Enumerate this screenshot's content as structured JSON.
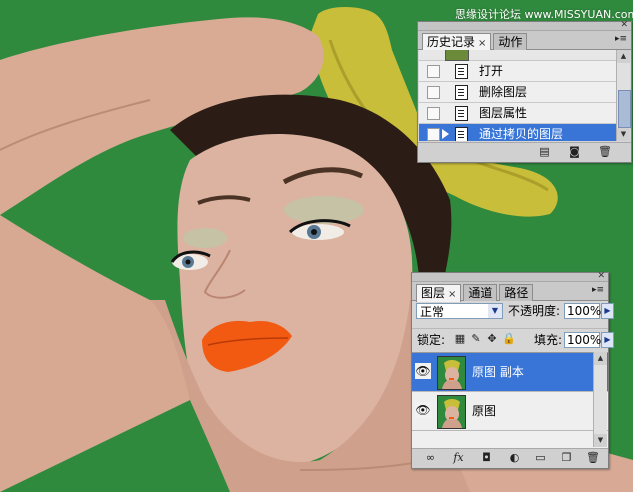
{
  "watermark": "思缘设计论坛 www.MISSYUAN.com",
  "colors": {
    "background_green": "#2f8a3e",
    "selection_blue": "#3875d7",
    "panel_gray": "#d6d6d6"
  },
  "history_panel": {
    "tabs": [
      {
        "label": "历史记录",
        "active": true,
        "close": "×"
      },
      {
        "label": "动作",
        "active": false
      }
    ],
    "menu_icon": "≡",
    "items": [
      {
        "label": "打开",
        "selected": false
      },
      {
        "label": "删除图层",
        "selected": false
      },
      {
        "label": "图层属性",
        "selected": false
      },
      {
        "label": "通过拷贝的图层",
        "selected": true
      }
    ],
    "footer_icons": [
      "new-document-from-state-icon",
      "new-snapshot-icon",
      "trash-icon"
    ]
  },
  "layers_panel": {
    "tabs": [
      {
        "label": "图层",
        "active": true,
        "close": "×"
      },
      {
        "label": "通道",
        "active": false
      },
      {
        "label": "路径",
        "active": false
      }
    ],
    "blend_mode": "正常",
    "opacity_label": "不透明度:",
    "opacity_value": "100%",
    "lock_label": "锁定:",
    "fill_label": "填充:",
    "fill_value": "100%",
    "layers": [
      {
        "name": "原图 副本",
        "visible": true,
        "selected": true
      },
      {
        "name": "原图",
        "visible": true,
        "selected": false
      }
    ],
    "footer_icons": [
      "link-icon",
      "fx-icon",
      "mask-icon",
      "adjustment-icon",
      "folder-icon",
      "new-layer-icon",
      "trash-icon"
    ],
    "fx_label": "fx"
  }
}
